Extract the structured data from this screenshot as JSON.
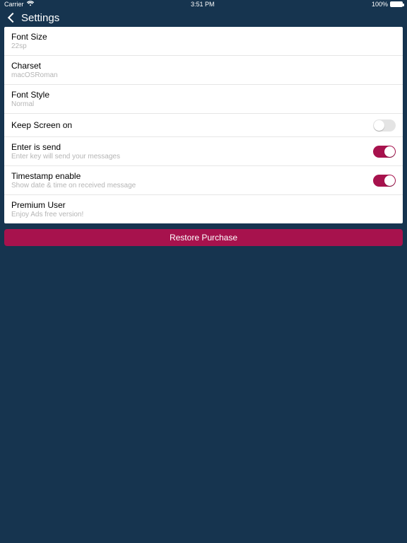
{
  "status": {
    "carrier": "Carrier",
    "time": "3:51 PM",
    "battery": "100%"
  },
  "nav": {
    "title": "Settings"
  },
  "rows": {
    "fontSize": {
      "title": "Font Size",
      "sub": "22sp"
    },
    "charset": {
      "title": "Charset",
      "sub": "macOSRoman"
    },
    "fontStyle": {
      "title": "Font Style",
      "sub": "Normal"
    },
    "keepScreen": {
      "title": "Keep Screen on",
      "on": false
    },
    "enterSend": {
      "title": "Enter is send",
      "sub": "Enter key will send your messages",
      "on": true
    },
    "timestamp": {
      "title": "Timestamp enable",
      "sub": "Show date & time on received message",
      "on": true
    },
    "premium": {
      "title": "Premium User",
      "sub": "Enjoy Ads free version!"
    }
  },
  "restore": {
    "label": "Restore Purchase"
  },
  "colors": {
    "accent": "#a7124d",
    "bg": "#16344f"
  }
}
